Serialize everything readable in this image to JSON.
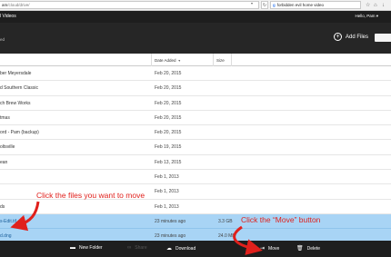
{
  "browser": {
    "url_host": "am",
    "url_path": "/cloud/drive/",
    "search_text": "forbidden evil home video"
  },
  "header": {
    "title": "l Videos",
    "user": "Hello, Pam"
  },
  "toolbar": {
    "folder_name": "ed",
    "add_files_label": "Add Files"
  },
  "table": {
    "columns": {
      "date": "Date Added",
      "size": "Size"
    },
    "rows": [
      {
        "name": "ber Meyersdale",
        "date": "Feb 20, 2015",
        "size": "",
        "selected": false
      },
      {
        "name": "d Southern Classic",
        "date": "Feb 20, 2015",
        "size": "",
        "selected": false
      },
      {
        "name": "ch Brew Works",
        "date": "Feb 20, 2015",
        "size": "",
        "selected": false
      },
      {
        "name": "tmas",
        "date": "Feb 20, 2015",
        "size": "",
        "selected": false
      },
      {
        "name": "ord - Pam (backup)",
        "date": "Feb 20, 2015",
        "size": "",
        "selected": false
      },
      {
        "name": "oltsville",
        "date": "Feb 19, 2015",
        "size": "",
        "selected": false
      },
      {
        "name": "ean",
        "date": "Feb 13, 2015",
        "size": "",
        "selected": false
      },
      {
        "name": "",
        "date": "Feb 1, 2013",
        "size": "",
        "selected": false
      },
      {
        "name": "",
        "date": "Feb 1, 2013",
        "size": "",
        "selected": false
      },
      {
        "name": "ds",
        "date": "Feb 1, 2013",
        "size": "",
        "selected": false
      },
      {
        "name": "s-Edit.tif",
        "date": "23 minutes ago",
        "size": "3.3 GB",
        "selected": true
      },
      {
        "name": "d.dng",
        "date": "23 minutes ago",
        "size": "24.0 MB",
        "selected": true
      }
    ]
  },
  "actions": {
    "new_folder": "New Folder",
    "share": "Share",
    "download": "Download",
    "move": "Move",
    "delete": "Delete"
  },
  "annotations": {
    "select_files": "Click the files you want to move",
    "move_button": "Click the “Move” button"
  },
  "colors": {
    "selection": "#a8d4f5",
    "header_bg": "#1e1e1e",
    "annotation": "#e0201c"
  }
}
